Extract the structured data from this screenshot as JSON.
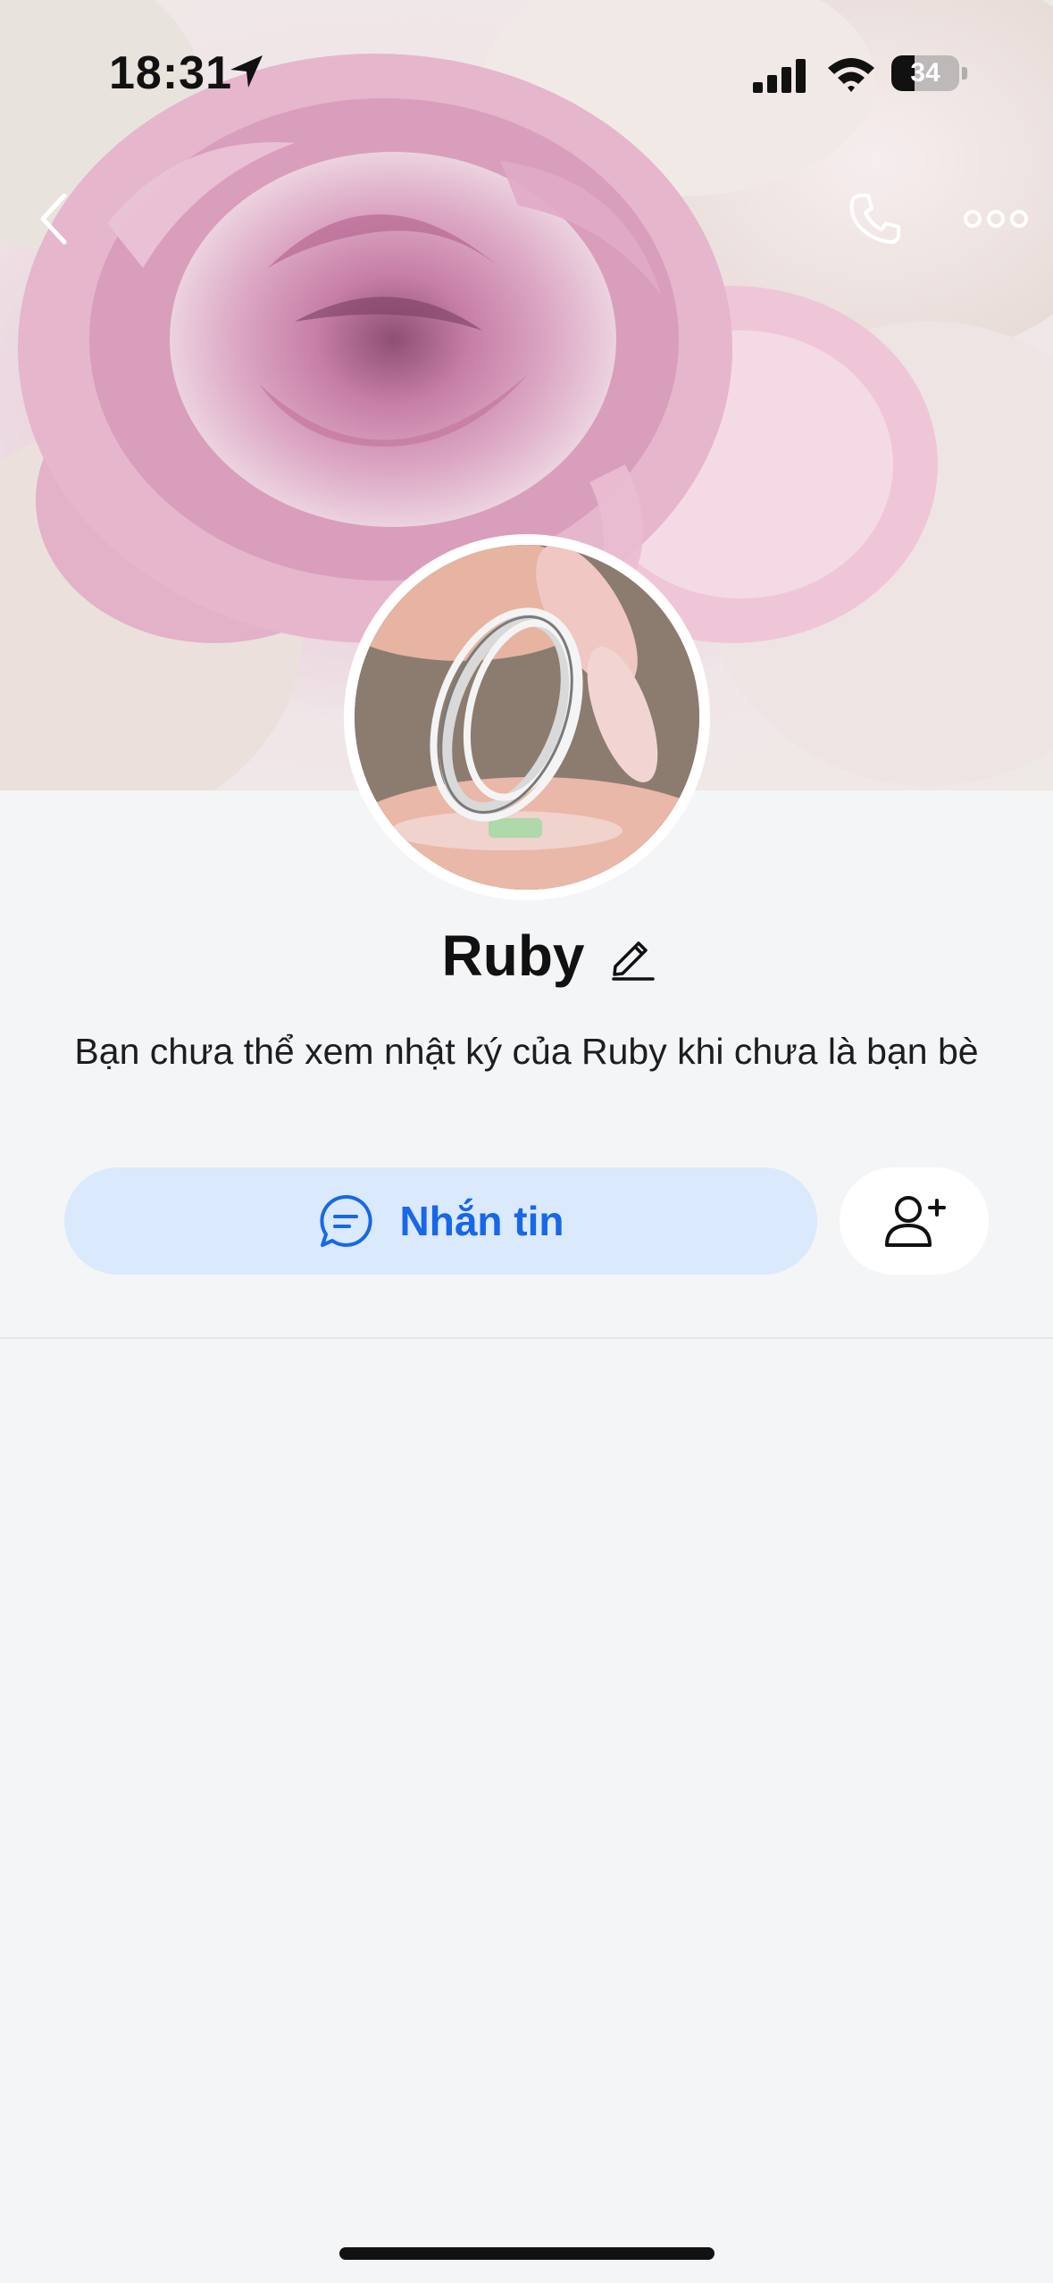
{
  "status_bar": {
    "time": "18:31",
    "battery": "34",
    "battery_level_percent": 34
  },
  "nav": {
    "back_icon": "chevron-left-icon",
    "call_icon": "phone-icon",
    "more_icon": "more-horizontal-icon"
  },
  "profile": {
    "name": "Ruby",
    "edit_icon": "pencil-icon",
    "notice": "Bạn chưa thể xem nhật ký của Ruby khi chưa là bạn bè"
  },
  "actions": {
    "message_label": "Nhắn tin",
    "message_icon": "chat-bubble-icon",
    "add_friend_icon": "add-user-icon"
  },
  "colors": {
    "accent": "#1767e8",
    "message_button_bg": "#dbe9fc",
    "page_bg": "#f4f5f7"
  }
}
